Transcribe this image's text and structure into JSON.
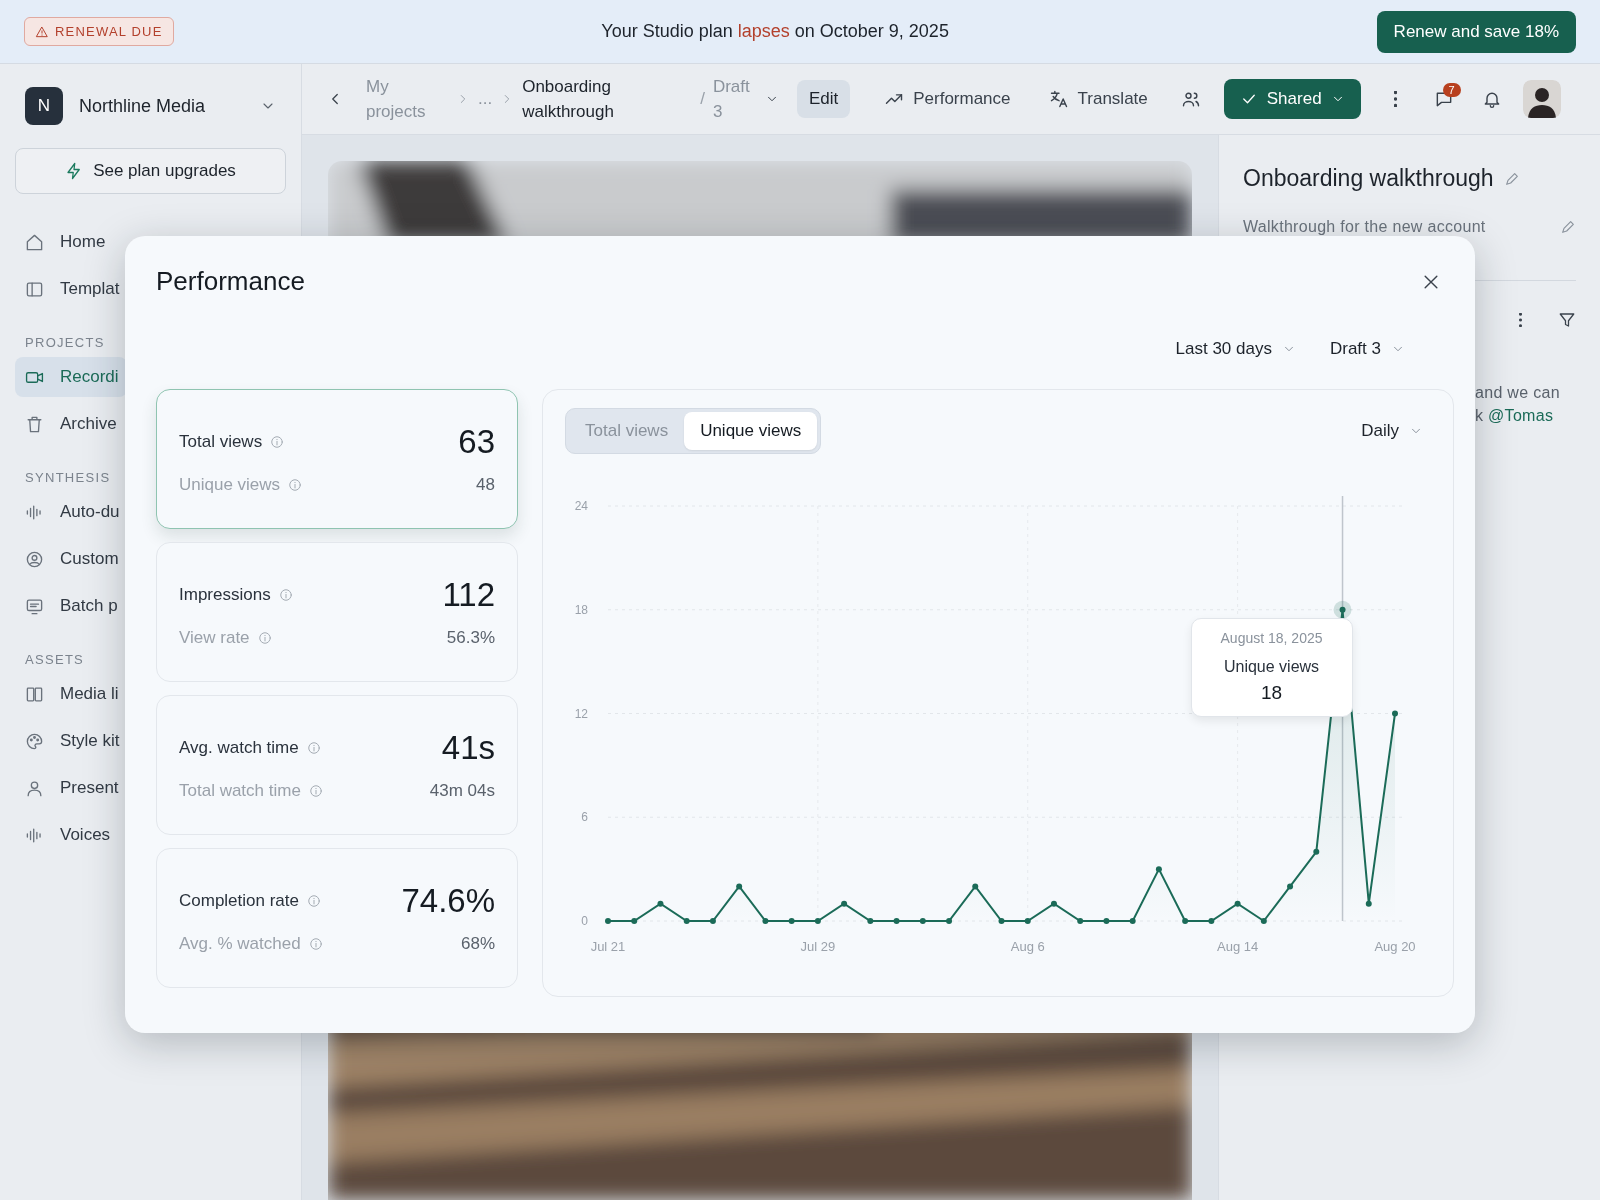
{
  "banner": {
    "badge": "RENEWAL DUE",
    "text_before": "Your Studio plan",
    "highlight": "lapses",
    "text_after": "on October 9, 2025",
    "button": "Renew and save 18%"
  },
  "workspace": {
    "initial": "N",
    "name": "Northline Media"
  },
  "upgrade_button": "See plan upgrades",
  "sidebar": {
    "sections": [
      {
        "items": [
          {
            "label": "Home",
            "selected": false
          },
          {
            "label": "Templat",
            "selected": false
          }
        ]
      },
      {
        "heading": "PROJECTS",
        "items": [
          {
            "label": "Recordi",
            "selected": true
          },
          {
            "label": "Archive",
            "selected": false
          }
        ]
      },
      {
        "heading": "SYNTHESIS",
        "items": [
          {
            "label": "Auto-du",
            "selected": false
          },
          {
            "label": "Custom",
            "selected": false
          },
          {
            "label": "Batch p",
            "selected": false
          }
        ]
      },
      {
        "heading": "ASSETS",
        "items": [
          {
            "label": "Media li",
            "selected": false
          },
          {
            "label": "Style kit",
            "selected": false
          },
          {
            "label": "Present",
            "selected": false
          },
          {
            "label": "Voices",
            "selected": false
          }
        ]
      }
    ]
  },
  "topbar": {
    "breadcrumb": {
      "parent": "My projects",
      "ellipsis": "...",
      "current": "Onboarding walkthrough",
      "separator": "/",
      "version": "Draft 3"
    },
    "edit_button": "Edit",
    "actions": [
      "Performance",
      "Translate"
    ],
    "share_button": "Shared",
    "comment_count": "7"
  },
  "right_panel": {
    "title": "Onboarding walkthrough",
    "description": "Walkthrough for the new account",
    "comment_lines": [
      "and we can",
      "k"
    ],
    "mention": "@Tomas"
  },
  "modal": {
    "title": "Performance",
    "filters": [
      "Last 30 days",
      "Draft 3"
    ],
    "stats": [
      {
        "label": "Total views",
        "value": "63",
        "sub_label": "Unique views",
        "sub_value": "48",
        "selected": true
      },
      {
        "label": "Impressions",
        "value": "112",
        "sub_label": "View rate",
        "sub_value": "56.3%",
        "selected": false
      },
      {
        "label": "Avg. watch time",
        "value": "41s",
        "sub_label": "Total watch time",
        "sub_value": "43m 04s",
        "selected": false
      },
      {
        "label": "Completion rate",
        "value": "74.6%",
        "sub_label": "Avg. % watched",
        "sub_value": "68%",
        "selected": false
      }
    ],
    "chart_tabs": [
      {
        "label": "Total views",
        "selected": false
      },
      {
        "label": "Unique views",
        "selected": true
      }
    ],
    "interval": "Daily",
    "chart_data": {
      "type": "line",
      "categories": [
        "Jul 21",
        null,
        null,
        null,
        null,
        null,
        null,
        null,
        "Jul 29",
        null,
        null,
        null,
        null,
        null,
        null,
        null,
        "Aug 6",
        null,
        null,
        null,
        null,
        null,
        null,
        null,
        "Aug 14",
        null,
        null,
        null,
        null,
        null,
        "Aug 20"
      ],
      "grid": true,
      "series": [
        {
          "name": "Unique views",
          "color": "#1b6b58",
          "marker": "o",
          "values": [
            0,
            0,
            1,
            0,
            0,
            2,
            0,
            0,
            0,
            1,
            0,
            0,
            0,
            0,
            2,
            0,
            0,
            1,
            0,
            0,
            0,
            3,
            0,
            0,
            1,
            0,
            2,
            4,
            18,
            1,
            12
          ]
        }
      ],
      "ylim": [
        0,
        24
      ],
      "yticks": [
        0,
        6,
        12,
        18,
        24
      ]
    },
    "tooltip": {
      "date": "August 18, 2025",
      "value": "18"
    }
  }
}
